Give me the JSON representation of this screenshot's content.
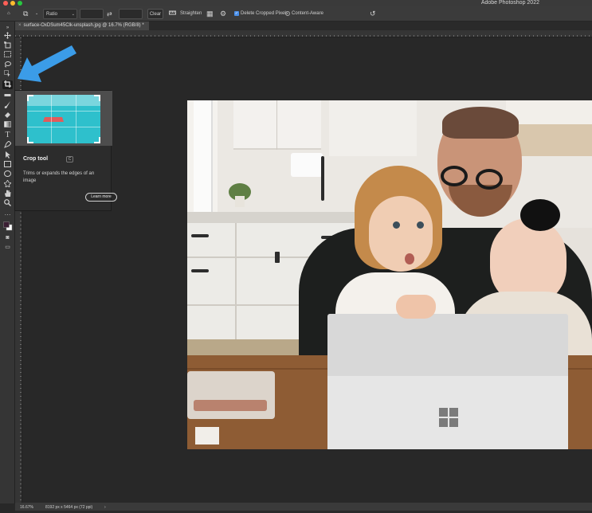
{
  "window": {
    "title": "Adobe Photoshop 2022"
  },
  "options_bar": {
    "ratio_label": "Ratio",
    "width_value": "",
    "height_value": "",
    "clear_label": "Clear",
    "straighten_label": "Straighten",
    "delete_cropped_label": "Delete Cropped Pixels",
    "delete_cropped_checked": true,
    "content_aware_label": "Content-Aware",
    "content_aware_checked": false
  },
  "document_tab": {
    "close": "×",
    "title": "surface-OxDSum45Clk-unsplash.jpg @ 16.7% (RGB/8) *"
  },
  "tooltip": {
    "title": "Crop tool",
    "shortcut": "C",
    "description": "Trims or expands the edges of an image",
    "learn_more": "Learn more"
  },
  "status_bar": {
    "zoom": "16.67%",
    "dimensions": "8192 px x 5464 px (72 ppi)",
    "arrow": "›"
  },
  "icons": {
    "home": "⌂",
    "crop": "⧉",
    "caret": "⌄",
    "swap": "⇄",
    "straighten": "📐",
    "grid": "▦",
    "gear": "⚙",
    "reset": "↺"
  },
  "colors": {
    "accent": "#4a8fe8",
    "arrow": "#3b9ce8",
    "foreground_swatch": "#3a1f33",
    "background_swatch": "#ffffff"
  }
}
